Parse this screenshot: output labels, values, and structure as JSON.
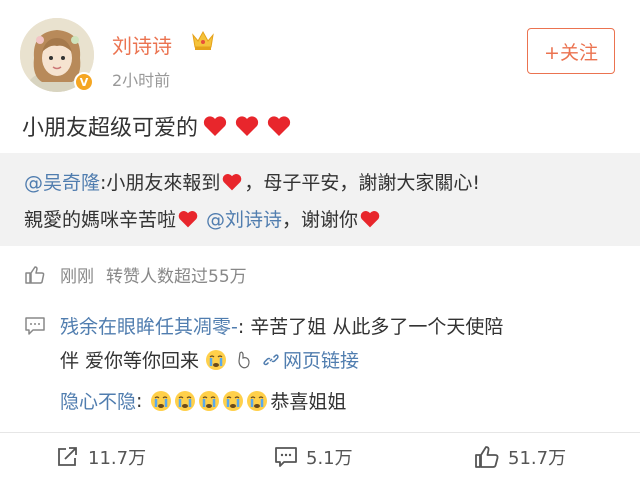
{
  "header": {
    "username": "刘诗诗",
    "time": "2小时前",
    "follow_label": "+关注",
    "verified_badge": "V"
  },
  "post": {
    "text": "小朋友超级可爱的",
    "hearts": 3
  },
  "repost": {
    "author": "@吴奇隆",
    "line1_text": ":小朋友來報到",
    "line1_tail": "，母子平安，謝謝大家關心!",
    "line2_text": "親愛的媽咪辛苦啦",
    "line2_mention": "@刘诗诗",
    "line2_tail": "，谢谢你"
  },
  "stats": {
    "time": "刚刚",
    "repost_count_text": "转赞人数超过55万"
  },
  "comments": [
    {
      "author": "残余在眼眸任其凋零-",
      "text1": ": 辛苦了姐 从此多了一个天使陪",
      "text2": "伴 爱你等你回来",
      "link": "网页链接"
    },
    {
      "author": "隐心不隐",
      "text": "恭喜姐姐",
      "emoji_count": 5
    }
  ],
  "actions": {
    "share": "11.7万",
    "comment": "5.1万",
    "like": "51.7万"
  },
  "colors": {
    "accent": "#eb7350",
    "link": "#507daf",
    "repost_bg": "#f2f2f2"
  }
}
